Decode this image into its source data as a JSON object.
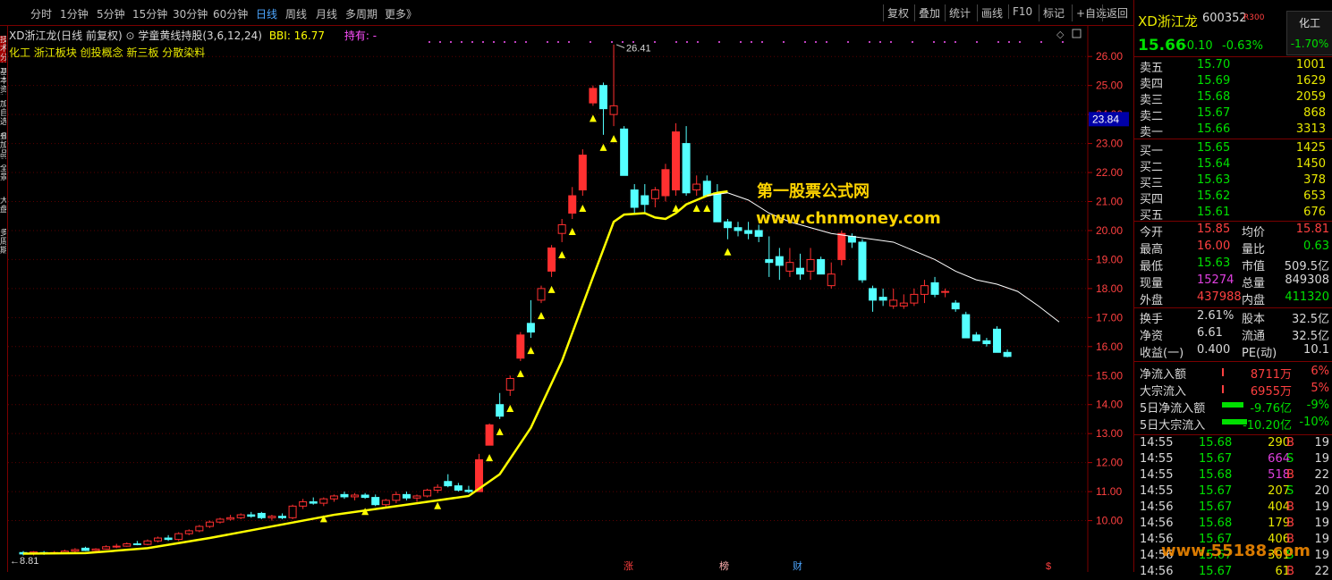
{
  "toolbar": {
    "periods": [
      "分时",
      "1分钟",
      "5分钟",
      "15分钟",
      "30分钟",
      "60分钟",
      "日线",
      "周线",
      "月线",
      "多周期",
      "更多》"
    ],
    "active_period": "日线",
    "right_buttons": [
      "复权",
      "叠加",
      "统计",
      "画线",
      "F10",
      "标记",
      "+自选",
      "返回"
    ]
  },
  "left_strip": [
    "分时",
    "技术分析",
    "基本资料",
    "加自选",
    "叠加品种",
    "全景",
    "大盘",
    "多周期"
  ],
  "chart_info": {
    "stock_label": "XD浙江龙(日线 前复权)",
    "indicator_label": "学童黄线持股(3,6,12,24)",
    "bbi_label": "BBI: 16.77",
    "hold_label": "持有: -",
    "concepts": "化工 浙江板块 创投概念 新三板 分散染料"
  },
  "watermark": {
    "line1": "第一股票公式网",
    "line2": "www.chnmoney.com"
  },
  "price_axis": {
    "labels": [
      "26.00",
      "25.00",
      "24.00",
      "23.00",
      "22.00",
      "21.00",
      "20.00",
      "19.00",
      "18.00",
      "17.00",
      "16.00",
      "15.00",
      "14.00",
      "13.00",
      "12.00",
      "11.00",
      "10.00"
    ],
    "current_marker": "23.84",
    "high_annotation": "26.41",
    "low_annotation": "8.81"
  },
  "bottom_markers": [
    "涨",
    "榜",
    "财",
    "$"
  ],
  "colors": {
    "up": "#ff3030",
    "down": "#54ffff",
    "bbi": "#ffff00",
    "ma": "#ffffff",
    "dots": "#c040c0"
  },
  "chart_data": {
    "type": "candlestick",
    "ylim": [
      8.6,
      26.9
    ],
    "candles": [
      {
        "o": 8.9,
        "h": 8.95,
        "l": 8.8,
        "c": 8.85
      },
      {
        "o": 8.85,
        "h": 8.95,
        "l": 8.8,
        "c": 8.92
      },
      {
        "o": 8.9,
        "h": 8.95,
        "l": 8.82,
        "c": 8.88
      },
      {
        "o": 8.88,
        "h": 8.95,
        "l": 8.84,
        "c": 8.9
      },
      {
        "o": 8.9,
        "h": 9.0,
        "l": 8.85,
        "c": 8.95
      },
      {
        "o": 8.95,
        "h": 9.05,
        "l": 8.9,
        "c": 9.0
      },
      {
        "o": 9.05,
        "h": 9.1,
        "l": 8.95,
        "c": 8.97
      },
      {
        "o": 8.97,
        "h": 9.05,
        "l": 8.92,
        "c": 9.02
      },
      {
        "o": 9.02,
        "h": 9.15,
        "l": 9.0,
        "c": 9.1
      },
      {
        "o": 9.1,
        "h": 9.2,
        "l": 9.05,
        "c": 9.12
      },
      {
        "o": 9.12,
        "h": 9.25,
        "l": 9.1,
        "c": 9.2
      },
      {
        "o": 9.2,
        "h": 9.3,
        "l": 9.15,
        "c": 9.18
      },
      {
        "o": 9.18,
        "h": 9.35,
        "l": 9.15,
        "c": 9.3
      },
      {
        "o": 9.3,
        "h": 9.45,
        "l": 9.25,
        "c": 9.4
      },
      {
        "o": 9.4,
        "h": 9.5,
        "l": 9.3,
        "c": 9.35
      },
      {
        "o": 9.35,
        "h": 9.6,
        "l": 9.3,
        "c": 9.55
      },
      {
        "o": 9.55,
        "h": 9.7,
        "l": 9.5,
        "c": 9.65
      },
      {
        "o": 9.65,
        "h": 9.85,
        "l": 9.6,
        "c": 9.8
      },
      {
        "o": 9.8,
        "h": 10.0,
        "l": 9.75,
        "c": 9.95
      },
      {
        "o": 9.95,
        "h": 10.1,
        "l": 9.9,
        "c": 10.05
      },
      {
        "o": 10.05,
        "h": 10.2,
        "l": 10.0,
        "c": 10.1
      },
      {
        "o": 10.1,
        "h": 10.25,
        "l": 10.05,
        "c": 10.2
      },
      {
        "o": 10.2,
        "h": 10.3,
        "l": 10.1,
        "c": 10.15
      },
      {
        "o": 10.25,
        "h": 10.3,
        "l": 10.05,
        "c": 10.1
      },
      {
        "o": 10.1,
        "h": 10.2,
        "l": 10.0,
        "c": 10.15
      },
      {
        "o": 10.15,
        "h": 10.25,
        "l": 10.05,
        "c": 10.1
      },
      {
        "o": 10.1,
        "h": 10.55,
        "l": 10.05,
        "c": 10.5
      },
      {
        "o": 10.5,
        "h": 10.75,
        "l": 10.4,
        "c": 10.65
      },
      {
        "o": 10.65,
        "h": 10.8,
        "l": 10.55,
        "c": 10.6
      },
      {
        "o": 10.6,
        "h": 10.8,
        "l": 10.5,
        "c": 10.75
      },
      {
        "o": 10.75,
        "h": 10.9,
        "l": 10.65,
        "c": 10.85
      },
      {
        "o": 10.9,
        "h": 11.0,
        "l": 10.75,
        "c": 10.82
      },
      {
        "o": 10.82,
        "h": 10.95,
        "l": 10.7,
        "c": 10.88
      },
      {
        "o": 10.88,
        "h": 10.95,
        "l": 10.75,
        "c": 10.8
      },
      {
        "o": 10.8,
        "h": 10.9,
        "l": 10.5,
        "c": 10.55
      },
      {
        "o": 10.55,
        "h": 10.75,
        "l": 10.45,
        "c": 10.7
      },
      {
        "o": 10.7,
        "h": 11.0,
        "l": 10.6,
        "c": 10.9
      },
      {
        "o": 10.9,
        "h": 11.0,
        "l": 10.7,
        "c": 10.78
      },
      {
        "o": 10.78,
        "h": 10.9,
        "l": 10.65,
        "c": 10.85
      },
      {
        "o": 10.85,
        "h": 11.1,
        "l": 10.8,
        "c": 11.05
      },
      {
        "o": 11.05,
        "h": 11.25,
        "l": 10.95,
        "c": 11.15
      },
      {
        "o": 11.35,
        "h": 11.6,
        "l": 11.15,
        "c": 11.2
      },
      {
        "o": 11.2,
        "h": 11.3,
        "l": 11.0,
        "c": 11.05
      },
      {
        "o": 11.05,
        "h": 11.2,
        "l": 10.95,
        "c": 11.0
      },
      {
        "o": 11.0,
        "h": 12.3,
        "l": 11.0,
        "c": 12.1
      },
      {
        "o": 12.6,
        "h": 13.35,
        "l": 12.6,
        "c": 13.3
      },
      {
        "o": 14.0,
        "h": 14.4,
        "l": 13.5,
        "c": 13.6
      },
      {
        "o": 14.5,
        "h": 15.0,
        "l": 14.3,
        "c": 14.9
      },
      {
        "o": 15.6,
        "h": 16.5,
        "l": 15.5,
        "c": 16.4
      },
      {
        "o": 16.8,
        "h": 17.6,
        "l": 16.3,
        "c": 16.5
      },
      {
        "o": 17.6,
        "h": 18.1,
        "l": 17.5,
        "c": 18.0
      },
      {
        "o": 18.6,
        "h": 19.5,
        "l": 18.4,
        "c": 19.4
      },
      {
        "o": 19.9,
        "h": 20.4,
        "l": 19.6,
        "c": 20.2
      },
      {
        "o": 20.6,
        "h": 21.5,
        "l": 20.4,
        "c": 21.2
      },
      {
        "o": 21.4,
        "h": 22.8,
        "l": 21.2,
        "c": 22.6
      },
      {
        "o": 24.4,
        "h": 25.0,
        "l": 24.3,
        "c": 24.9
      },
      {
        "o": 25.0,
        "h": 25.1,
        "l": 23.3,
        "c": 24.2
      },
      {
        "o": 24.0,
        "h": 26.41,
        "l": 23.6,
        "c": 24.3
      },
      {
        "o": 23.5,
        "h": 23.6,
        "l": 21.9,
        "c": 21.9
      },
      {
        "o": 21.4,
        "h": 21.6,
        "l": 20.6,
        "c": 20.8
      },
      {
        "o": 21.2,
        "h": 21.6,
        "l": 20.6,
        "c": 20.9
      },
      {
        "o": 21.1,
        "h": 21.5,
        "l": 20.8,
        "c": 21.4
      },
      {
        "o": 21.2,
        "h": 22.3,
        "l": 21.0,
        "c": 22.1
      },
      {
        "o": 21.4,
        "h": 23.7,
        "l": 21.2,
        "c": 23.4
      },
      {
        "o": 23.0,
        "h": 23.6,
        "l": 21.2,
        "c": 21.3
      },
      {
        "o": 21.4,
        "h": 21.9,
        "l": 21.2,
        "c": 21.6
      },
      {
        "o": 21.7,
        "h": 21.9,
        "l": 21.2,
        "c": 21.2
      },
      {
        "o": 21.3,
        "h": 21.6,
        "l": 20.3,
        "c": 20.3
      },
      {
        "o": 20.3,
        "h": 20.4,
        "l": 19.7,
        "c": 20.1
      },
      {
        "o": 20.1,
        "h": 20.3,
        "l": 19.8,
        "c": 20.0
      },
      {
        "o": 20.0,
        "h": 20.3,
        "l": 19.7,
        "c": 19.9
      },
      {
        "o": 20.0,
        "h": 20.2,
        "l": 19.6,
        "c": 19.8
      },
      {
        "o": 19.0,
        "h": 19.8,
        "l": 18.4,
        "c": 18.9
      },
      {
        "o": 19.1,
        "h": 19.4,
        "l": 18.3,
        "c": 18.8
      },
      {
        "o": 18.6,
        "h": 19.4,
        "l": 18.4,
        "c": 18.9
      },
      {
        "o": 18.7,
        "h": 19.2,
        "l": 18.3,
        "c": 18.5
      },
      {
        "o": 18.6,
        "h": 19.4,
        "l": 18.3,
        "c": 19.0
      },
      {
        "o": 19.0,
        "h": 19.1,
        "l": 18.5,
        "c": 18.5
      },
      {
        "o": 18.1,
        "h": 18.9,
        "l": 18.0,
        "c": 18.5
      },
      {
        "o": 19.0,
        "h": 20.0,
        "l": 18.8,
        "c": 19.9
      },
      {
        "o": 19.8,
        "h": 19.9,
        "l": 19.4,
        "c": 19.6
      },
      {
        "o": 19.6,
        "h": 19.7,
        "l": 18.2,
        "c": 18.3
      },
      {
        "o": 18.0,
        "h": 18.1,
        "l": 17.2,
        "c": 17.6
      },
      {
        "o": 17.7,
        "h": 18.0,
        "l": 17.4,
        "c": 17.6
      },
      {
        "o": 17.4,
        "h": 18.0,
        "l": 17.3,
        "c": 17.6
      },
      {
        "o": 17.4,
        "h": 17.8,
        "l": 17.3,
        "c": 17.5
      },
      {
        "o": 17.5,
        "h": 18.0,
        "l": 17.4,
        "c": 17.8
      },
      {
        "o": 17.8,
        "h": 18.3,
        "l": 17.5,
        "c": 18.1
      },
      {
        "o": 18.2,
        "h": 18.4,
        "l": 17.7,
        "c": 17.8
      },
      {
        "o": 17.9,
        "h": 18.0,
        "l": 17.7,
        "c": 17.9
      },
      {
        "o": 17.5,
        "h": 17.6,
        "l": 17.2,
        "c": 17.3
      },
      {
        "o": 17.1,
        "h": 17.2,
        "l": 16.3,
        "c": 16.3
      },
      {
        "o": 16.4,
        "h": 16.5,
        "l": 16.2,
        "c": 16.2
      },
      {
        "o": 16.2,
        "h": 16.3,
        "l": 16.0,
        "c": 16.1
      },
      {
        "o": 16.6,
        "h": 16.7,
        "l": 15.8,
        "c": 15.8
      },
      {
        "o": 15.8,
        "h": 15.9,
        "l": 15.63,
        "c": 15.66
      }
    ],
    "bbi_line": [
      [
        0,
        8.86
      ],
      [
        6,
        8.88
      ],
      [
        12,
        9.05
      ],
      [
        18,
        9.4
      ],
      [
        24,
        9.8
      ],
      [
        30,
        10.2
      ],
      [
        35,
        10.45
      ],
      [
        40,
        10.7
      ],
      [
        43,
        10.85
      ],
      [
        46,
        11.6
      ],
      [
        49,
        13.2
      ],
      [
        52,
        15.5
      ],
      [
        55,
        18.4
      ],
      [
        57,
        20.3
      ],
      [
        58,
        20.55
      ],
      [
        60,
        20.6
      ],
      [
        61,
        20.45
      ],
      [
        62,
        20.4
      ],
      [
        63,
        20.6
      ],
      [
        64,
        20.9
      ],
      [
        66,
        21.2
      ],
      [
        67,
        21.3
      ],
      [
        68,
        21.35
      ]
    ],
    "ma_line": [
      [
        66,
        21.2
      ],
      [
        68,
        21.3
      ],
      [
        70,
        21.05
      ],
      [
        72,
        20.6
      ],
      [
        74,
        20.3
      ],
      [
        76,
        20.1
      ],
      [
        78,
        19.9
      ],
      [
        80,
        19.8
      ],
      [
        82,
        19.7
      ],
      [
        84,
        19.6
      ],
      [
        86,
        19.3
      ],
      [
        88,
        19.0
      ],
      [
        90,
        18.6
      ],
      [
        92,
        18.3
      ],
      [
        94,
        18.15
      ],
      [
        96,
        17.9
      ],
      [
        98,
        17.4
      ],
      [
        100,
        16.85
      ]
    ],
    "buy_markers": [
      29,
      33,
      40,
      45,
      46,
      47,
      48,
      49,
      50,
      51,
      52,
      53,
      54,
      55,
      56,
      57,
      63,
      65,
      66,
      68
    ]
  },
  "quote_panel": {
    "name": "XD浙江龙",
    "code": "600352",
    "badge": "R300",
    "sector": "化工",
    "sector_change": "-1.70%",
    "price": "15.66",
    "change": "-0.10",
    "change_pct": "-0.63%",
    "asks": [
      [
        "卖五",
        "15.70",
        "1001"
      ],
      [
        "卖四",
        "15.69",
        "1629"
      ],
      [
        "卖三",
        "15.68",
        "2059"
      ],
      [
        "卖二",
        "15.67",
        "868"
      ],
      [
        "卖一",
        "15.66",
        "3313"
      ]
    ],
    "bids": [
      [
        "买一",
        "15.65",
        "1425"
      ],
      [
        "买二",
        "15.64",
        "1450"
      ],
      [
        "买三",
        "15.63",
        "378"
      ],
      [
        "买四",
        "15.62",
        "653"
      ],
      [
        "买五",
        "15.61",
        "676"
      ]
    ],
    "stats": [
      [
        "今开",
        "15.85",
        "均价",
        "15.81"
      ],
      [
        "最高",
        "16.00",
        "量比",
        "0.63"
      ],
      [
        "最低",
        "15.63",
        "市值",
        "509.5亿"
      ],
      [
        "现量",
        "15274",
        "总量",
        "849308"
      ],
      [
        "外盘",
        "437988",
        "内盘",
        "411320"
      ]
    ],
    "stats2": [
      [
        "换手",
        "2.61%",
        "股本",
        "32.5亿"
      ],
      [
        "净资",
        "6.61",
        "流通",
        "32.5亿"
      ],
      [
        "收益(一)",
        "0.400",
        "PE(动)",
        "10.1"
      ]
    ],
    "flows": [
      [
        "净流入额",
        "8711万",
        "6%"
      ],
      [
        "大宗流入",
        "6955万",
        "5%"
      ],
      [
        "5日净流入额",
        "-9.76亿",
        "-9%"
      ],
      [
        "5日大宗流入",
        "-10.20亿",
        "-10%"
      ]
    ],
    "ticks": [
      [
        "14:55",
        "15.68",
        "290",
        "B",
        "19"
      ],
      [
        "14:55",
        "15.67",
        "664",
        "S",
        "19"
      ],
      [
        "14:55",
        "15.68",
        "518",
        "B",
        "22"
      ],
      [
        "14:55",
        "15.67",
        "207",
        "S",
        "20"
      ],
      [
        "14:56",
        "15.67",
        "404",
        "B",
        "19"
      ],
      [
        "14:56",
        "15.68",
        "179",
        "B",
        "19"
      ],
      [
        "14:56",
        "15.67",
        "406",
        "B",
        "19"
      ],
      [
        "14:56",
        "15.67",
        "301",
        "S",
        "19"
      ],
      [
        "14:56",
        "15.67",
        "61",
        "B",
        "22"
      ]
    ],
    "watermark": "www.55188.com"
  }
}
